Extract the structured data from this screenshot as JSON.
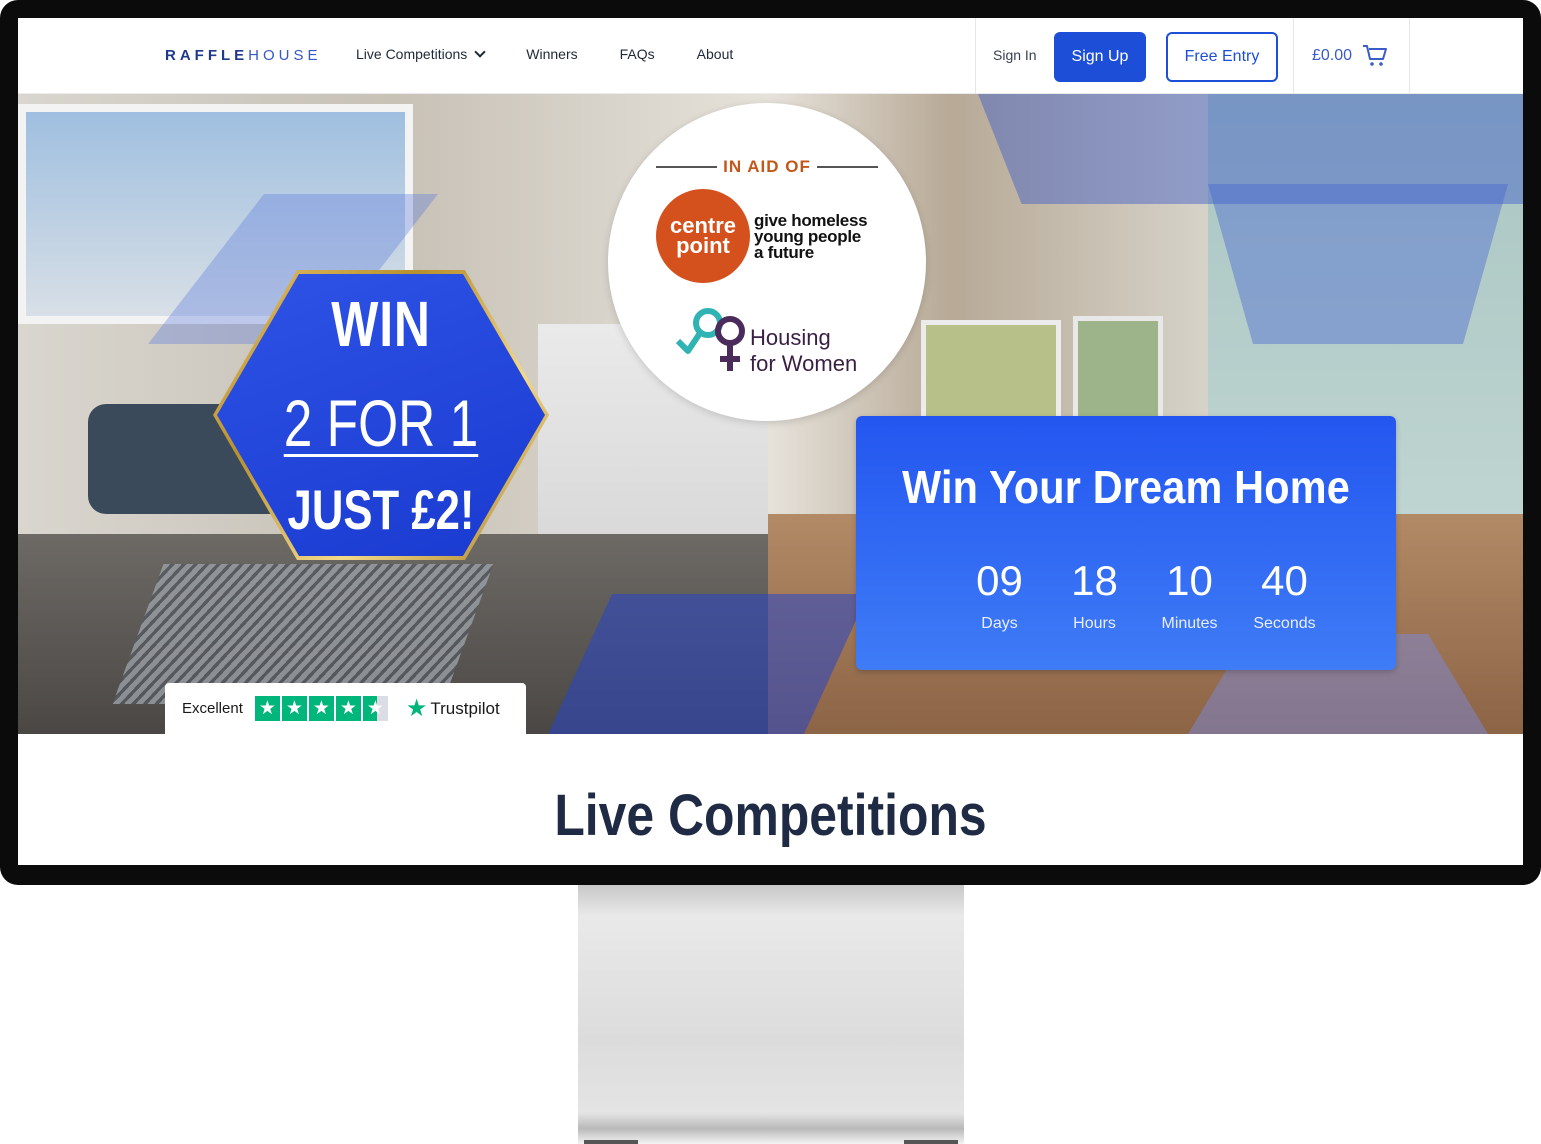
{
  "header": {
    "logo_bold": "RAFFLE",
    "logo_light": "HOUSE",
    "nav": [
      {
        "label": "Live Competitions"
      },
      {
        "label": "Winners"
      },
      {
        "label": "FAQs"
      },
      {
        "label": "About"
      }
    ],
    "sign_in": "Sign In",
    "sign_up": "Sign Up",
    "free_entry": "Free Entry",
    "cart_total": "£0.00"
  },
  "hero": {
    "offer": {
      "line1": "WIN",
      "line2": "2 FOR 1",
      "line3": "JUST £2!"
    },
    "charity": {
      "in_aid_of": "IN AID OF",
      "centrepoint_1": "centre",
      "centrepoint_2": "point",
      "centrepoint_tag_1": "give homeless",
      "centrepoint_tag_2": "young people",
      "centrepoint_tag_3": "a future",
      "hfw_1": "Housing",
      "hfw_2": "for Women"
    },
    "countdown": {
      "title": "Win Your Dream Home",
      "units": [
        {
          "value": "09",
          "label": "Days"
        },
        {
          "value": "18",
          "label": "Hours"
        },
        {
          "value": "10",
          "label": "Minutes"
        },
        {
          "value": "40",
          "label": "Seconds"
        }
      ]
    },
    "trustpilot": {
      "rating_text": "Excellent",
      "stars": 4.5,
      "brand": "Trustpilot"
    }
  },
  "main": {
    "section_title": "Live Competitions"
  },
  "colors": {
    "brand_blue": "#1d4ed8",
    "trustpilot_green": "#00b67a",
    "centrepoint_orange": "#d4501c"
  }
}
